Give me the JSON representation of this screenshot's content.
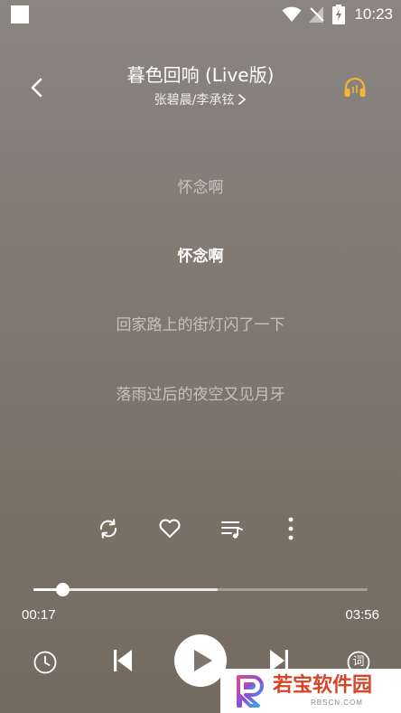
{
  "status_bar": {
    "time": "10:23",
    "icons": [
      "notification-square-icon",
      "wifi-icon",
      "no-signal-icon",
      "battery-charging-icon"
    ]
  },
  "header": {
    "title": "暮色回响 (Live版)",
    "artist": "张碧晨/李承铉",
    "back_icon": "chevron-left-icon",
    "right_icon": "headphone-icon"
  },
  "lyrics": {
    "lines": [
      {
        "text": "怀念啊",
        "active": false
      },
      {
        "text": "怀念啊",
        "active": true
      },
      {
        "text": "回家路上的街灯闪了一下",
        "active": false
      },
      {
        "text": "落雨过后的夜空又见月牙",
        "active": false
      }
    ]
  },
  "actions": {
    "icons": [
      "repeat-icon",
      "heart-icon",
      "playlist-icon",
      "more-vertical-icon"
    ]
  },
  "player": {
    "elapsed": "00:17",
    "total": "03:56",
    "progress_fraction": 0.072,
    "buffered_fraction": 0.55
  },
  "controls": {
    "icons": [
      "sleep-timer-icon",
      "previous-icon",
      "play-icon",
      "next-icon",
      "lyrics-icon"
    ],
    "lyrics_glyph": "词"
  },
  "watermark": {
    "text": "若宝软件园",
    "sub": "RBSCN.COM"
  },
  "colors": {
    "background": "#807870",
    "accent_headphone": "#f2b534",
    "watermark_red": "#d6452a"
  }
}
